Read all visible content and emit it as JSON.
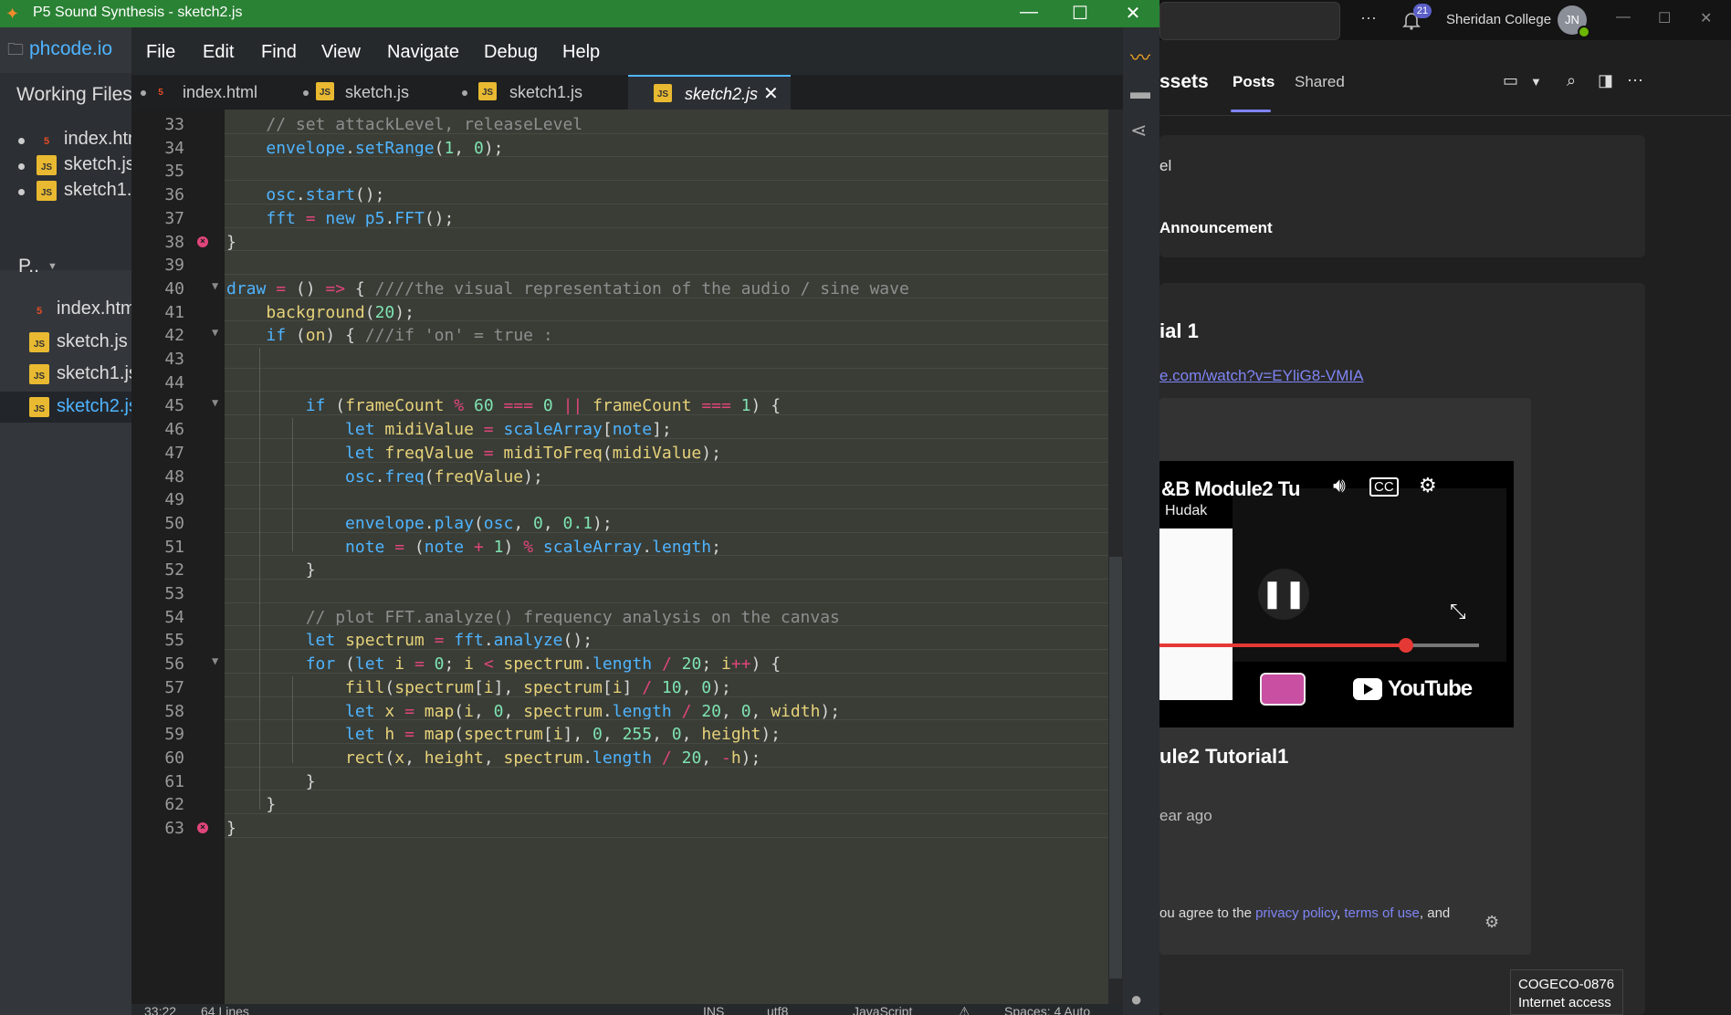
{
  "window": {
    "title": "P5 Sound Synthesis - sketch2.js",
    "minimize": "—",
    "maximize": "☐",
    "close": "✕"
  },
  "sidebar": {
    "brand": "phcode.io",
    "working_files_label": "Working Files",
    "working_files": [
      {
        "name": "index.html",
        "type": "html"
      },
      {
        "name": "sketch.js",
        "type": "js"
      },
      {
        "name": "sketch1.js",
        "type": "js"
      }
    ],
    "project_label": "P..",
    "project_files": [
      {
        "name": "index.html",
        "type": "html"
      },
      {
        "name": "sketch.js",
        "type": "js"
      },
      {
        "name": "sketch1.js",
        "type": "js"
      },
      {
        "name": "sketch2.js",
        "type": "js",
        "selected": true
      }
    ]
  },
  "menu": [
    "File",
    "Edit",
    "Find",
    "View",
    "Navigate",
    "Debug",
    "Help"
  ],
  "tabs": [
    {
      "name": "index.html",
      "type": "html"
    },
    {
      "name": "sketch.js",
      "type": "js"
    },
    {
      "name": "sketch1.js",
      "type": "js"
    },
    {
      "name": "sketch2.js",
      "type": "js",
      "active": true
    }
  ],
  "tab_close": "✕",
  "code_lines": [
    {
      "n": "33",
      "indent": 1,
      "text": "// set attackLevel, releaseLevel"
    },
    {
      "n": "34",
      "indent": 1,
      "text": "envelope.setRange(1, 0);"
    },
    {
      "n": "35",
      "indent": 0,
      "text": ""
    },
    {
      "n": "36",
      "indent": 1,
      "text": "osc.start();"
    },
    {
      "n": "37",
      "indent": 1,
      "text": "fft = new p5.FFT();"
    },
    {
      "n": "38",
      "indent": 0,
      "text": "}",
      "error": true
    },
    {
      "n": "39",
      "indent": 0,
      "text": ""
    },
    {
      "n": "40",
      "indent": 0,
      "text": "draw = () => { ////the visual representation of the audio / sine wave",
      "fold": true
    },
    {
      "n": "41",
      "indent": 1,
      "text": "background(20);"
    },
    {
      "n": "42",
      "indent": 1,
      "text": "if (on) { ///if 'on' = true :",
      "fold": true
    },
    {
      "n": "43",
      "indent": 0,
      "text": ""
    },
    {
      "n": "44",
      "indent": 0,
      "text": ""
    },
    {
      "n": "45",
      "indent": 2,
      "text": "if (frameCount % 60 === 0 || frameCount === 1) {",
      "fold": true
    },
    {
      "n": "46",
      "indent": 3,
      "text": "let midiValue = scaleArray[note];"
    },
    {
      "n": "47",
      "indent": 3,
      "text": "let freqValue = midiToFreq(midiValue);"
    },
    {
      "n": "48",
      "indent": 3,
      "text": "osc.freq(freqValue);"
    },
    {
      "n": "49",
      "indent": 0,
      "text": ""
    },
    {
      "n": "50",
      "indent": 3,
      "text": "envelope.play(osc, 0, 0.1);"
    },
    {
      "n": "51",
      "indent": 3,
      "text": "note = (note + 1) % scaleArray.length;"
    },
    {
      "n": "52",
      "indent": 2,
      "text": "}"
    },
    {
      "n": "53",
      "indent": 0,
      "text": ""
    },
    {
      "n": "54",
      "indent": 2,
      "text": "// plot FFT.analyze() frequency analysis on the canvas"
    },
    {
      "n": "55",
      "indent": 2,
      "text": "let spectrum = fft.analyze();"
    },
    {
      "n": "56",
      "indent": 2,
      "text": "for (let i = 0; i < spectrum.length / 20; i++) {",
      "fold": true
    },
    {
      "n": "57",
      "indent": 3,
      "text": "fill(spectrum[i], spectrum[i] / 10, 0);"
    },
    {
      "n": "58",
      "indent": 3,
      "text": "let x = map(i, 0, spectrum.length / 20, 0, width);"
    },
    {
      "n": "59",
      "indent": 3,
      "text": "let h = map(spectrum[i], 0, 255, 0, height);"
    },
    {
      "n": "60",
      "indent": 3,
      "text": "rect(x, height, spectrum.length / 20, -h);"
    },
    {
      "n": "61",
      "indent": 2,
      "text": "}"
    },
    {
      "n": "62",
      "indent": 1,
      "text": "}"
    },
    {
      "n": "63",
      "indent": 0,
      "text": "}",
      "error": true
    }
  ],
  "status": {
    "cursor": "33:22",
    "lines": "64 Lines",
    "mode": "INS",
    "encoding": "utf8",
    "language": "JavaScript",
    "spaces": "Spaces: 4  Auto"
  },
  "teams": {
    "notifications": "21",
    "org": "Sheridan College",
    "avatar": "JN",
    "channel_name": "ssets",
    "tabs": [
      "Posts",
      "Shared"
    ],
    "card1_line1": "el",
    "card1_line2": "Announcement",
    "post_title": "ial 1",
    "post_link": "e.com/watch?v=EYliG8-VMIA",
    "video_title": "&B Module2 Tu",
    "video_author": "Hudak",
    "video_brand": "YouTube",
    "post_heading": "ule2 Tutorial1",
    "post_time": "ear ago",
    "terms_prefix": "ou agree to the ",
    "privacy": "privacy policy",
    "terms": "terms of use",
    "terms_suffix": ", and",
    "network_name": "COGECO-0876",
    "network_status": "Internet access"
  }
}
